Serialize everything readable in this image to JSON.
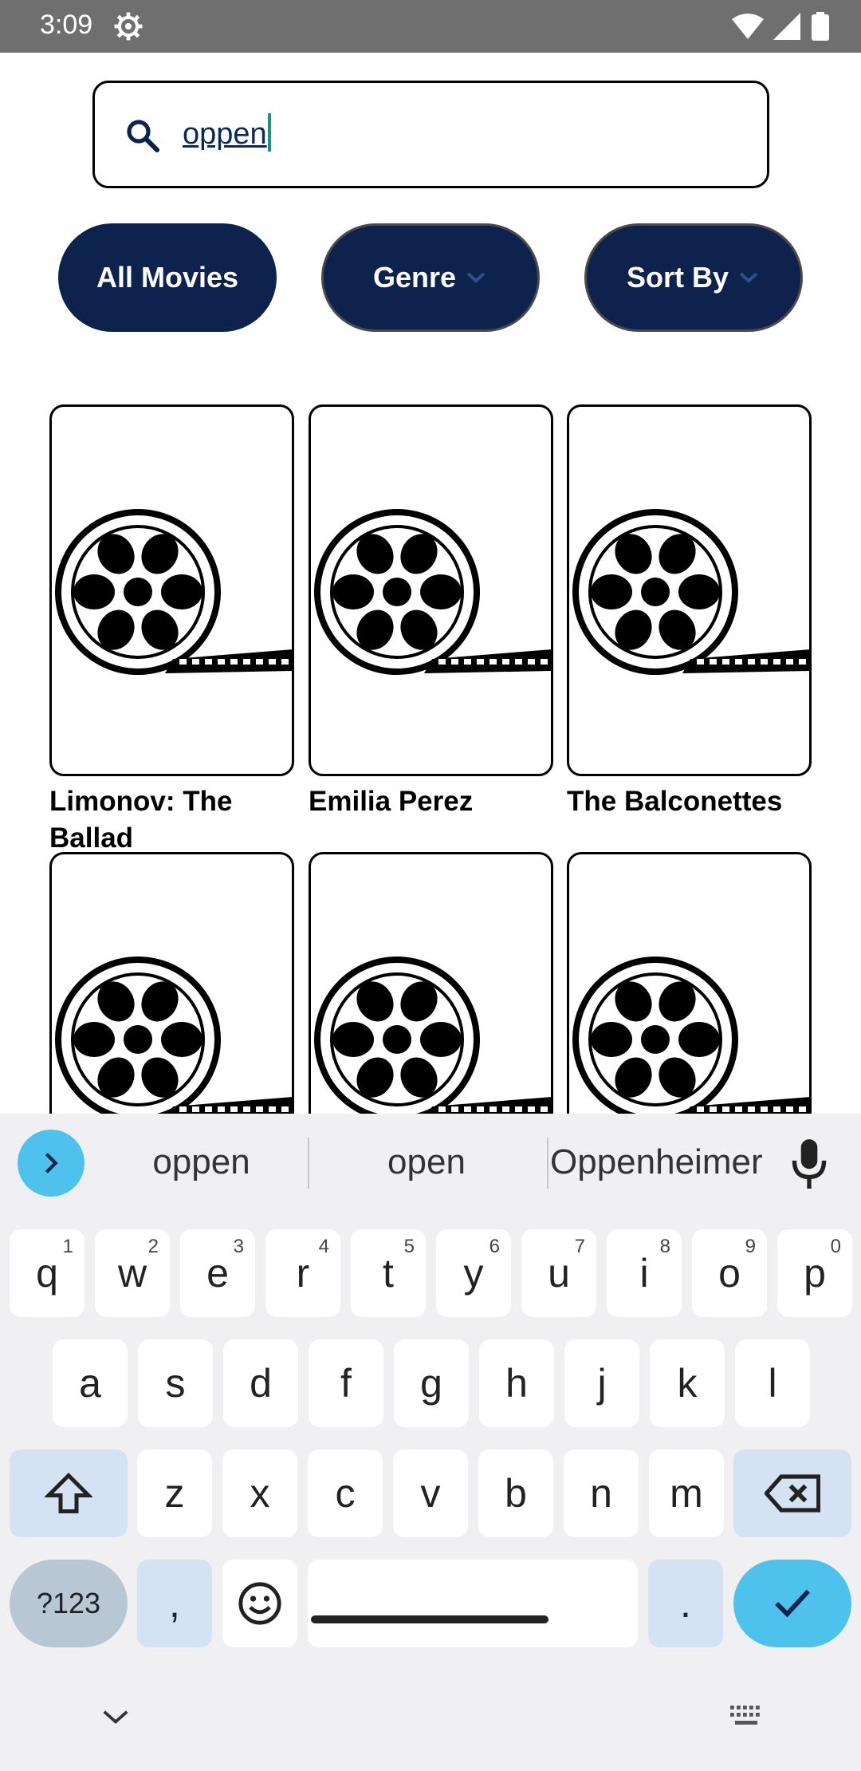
{
  "status": {
    "time": "3:09"
  },
  "search": {
    "value": "oppen"
  },
  "filters": {
    "all_movies": "All Movies",
    "genre": "Genre",
    "sort_by": "Sort By"
  },
  "movies": [
    {
      "title": "Limonov: The Ballad"
    },
    {
      "title": "Emilia Perez"
    },
    {
      "title": "The Balconettes"
    },
    {
      "title": ""
    },
    {
      "title": ""
    },
    {
      "title": ""
    }
  ],
  "keyboard": {
    "suggestions": [
      "oppen",
      "open",
      "Oppenheimer"
    ],
    "row1": [
      {
        "k": "q",
        "h": "1"
      },
      {
        "k": "w",
        "h": "2"
      },
      {
        "k": "e",
        "h": "3"
      },
      {
        "k": "r",
        "h": "4"
      },
      {
        "k": "t",
        "h": "5"
      },
      {
        "k": "y",
        "h": "6"
      },
      {
        "k": "u",
        "h": "7"
      },
      {
        "k": "i",
        "h": "8"
      },
      {
        "k": "o",
        "h": "9"
      },
      {
        "k": "p",
        "h": "0"
      }
    ],
    "row2": [
      "a",
      "s",
      "d",
      "f",
      "g",
      "h",
      "j",
      "k",
      "l"
    ],
    "row3": [
      "z",
      "x",
      "c",
      "v",
      "b",
      "n",
      "m"
    ],
    "symbols_label": "?123",
    "comma": ",",
    "period": "."
  },
  "colors": {
    "navy": "#0d224d",
    "accent": "#4cc2ec",
    "caret": "#1a8f83"
  }
}
